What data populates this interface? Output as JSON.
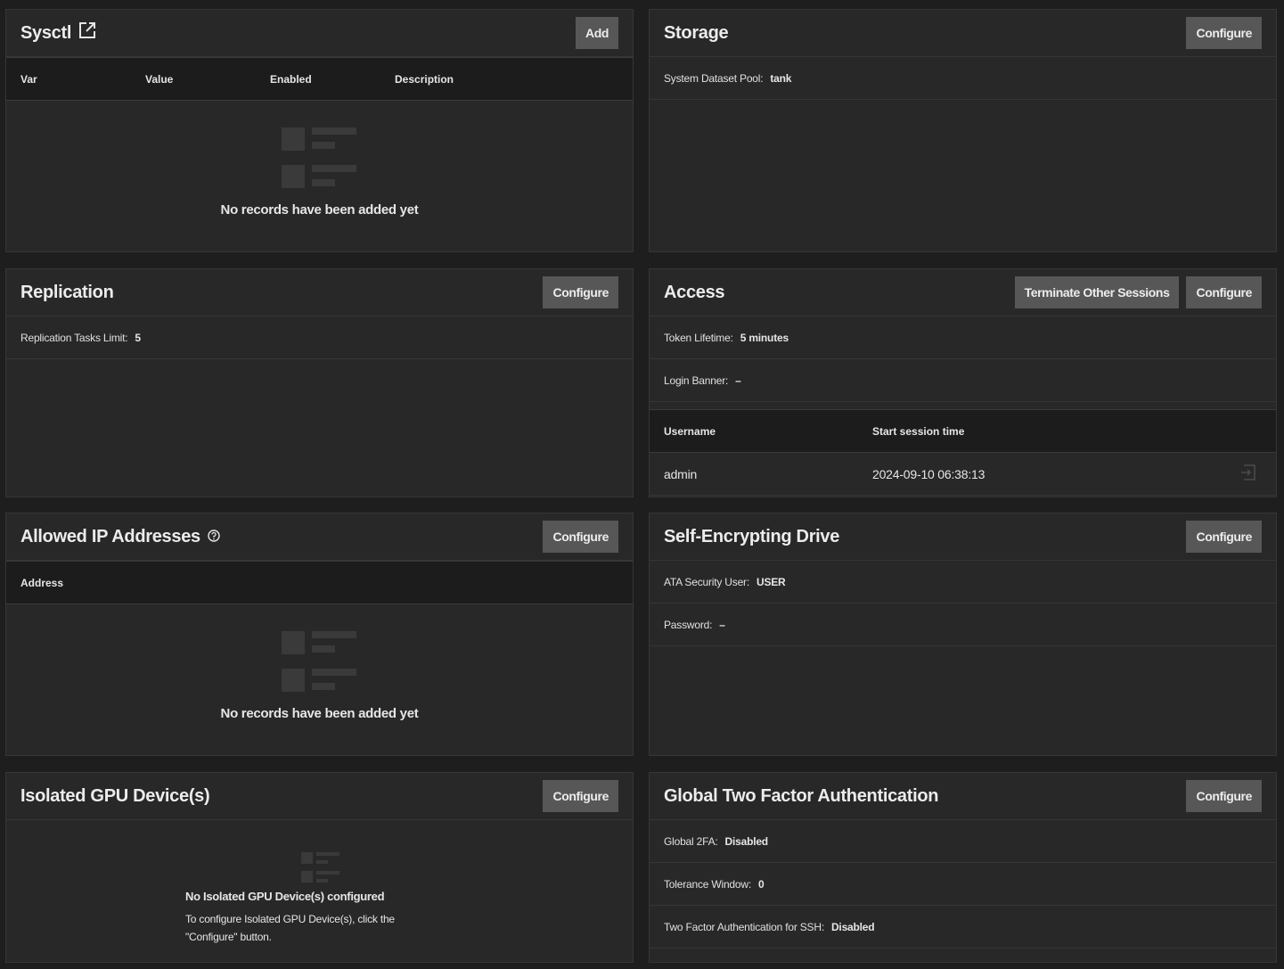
{
  "sysctl": {
    "title": "Sysctl",
    "add": "Add",
    "columns": [
      "Var",
      "Value",
      "Enabled",
      "Description"
    ],
    "empty": "No records have been added yet"
  },
  "storage": {
    "title": "Storage",
    "configure": "Configure",
    "pool_label": "System Dataset Pool:",
    "pool_value": "tank"
  },
  "replication": {
    "title": "Replication",
    "configure": "Configure",
    "limit_label": "Replication Tasks Limit:",
    "limit_value": "5"
  },
  "access": {
    "title": "Access",
    "terminate": "Terminate Other Sessions",
    "configure": "Configure",
    "token_label": "Token Lifetime:",
    "token_value": "5 minutes",
    "banner_label": "Login Banner:",
    "banner_value": "–",
    "columns": [
      "Username",
      "Start session time"
    ],
    "sessions": [
      {
        "username": "admin",
        "start": "2024-09-10 06:38:13"
      }
    ]
  },
  "allowed_ip": {
    "title": "Allowed IP Addresses",
    "configure": "Configure",
    "columns": [
      "Address"
    ],
    "empty": "No records have been added yet"
  },
  "sed": {
    "title": "Self-Encrypting Drive",
    "configure": "Configure",
    "user_label": "ATA Security User:",
    "user_value": "USER",
    "password_label": "Password:",
    "password_value": "–"
  },
  "gpu": {
    "title": "Isolated GPU Device(s)",
    "configure": "Configure",
    "empty_title": "No Isolated GPU Device(s) configured",
    "empty_desc": "To configure Isolated GPU Device(s), click the \"Configure\" button."
  },
  "twofa": {
    "title": "Global Two Factor Authentication",
    "configure": "Configure",
    "global_label": "Global 2FA:",
    "global_value": "Disabled",
    "window_label": "Tolerance Window:",
    "window_value": "0",
    "ssh_label": "Two Factor Authentication for SSH:",
    "ssh_value": "Disabled"
  }
}
